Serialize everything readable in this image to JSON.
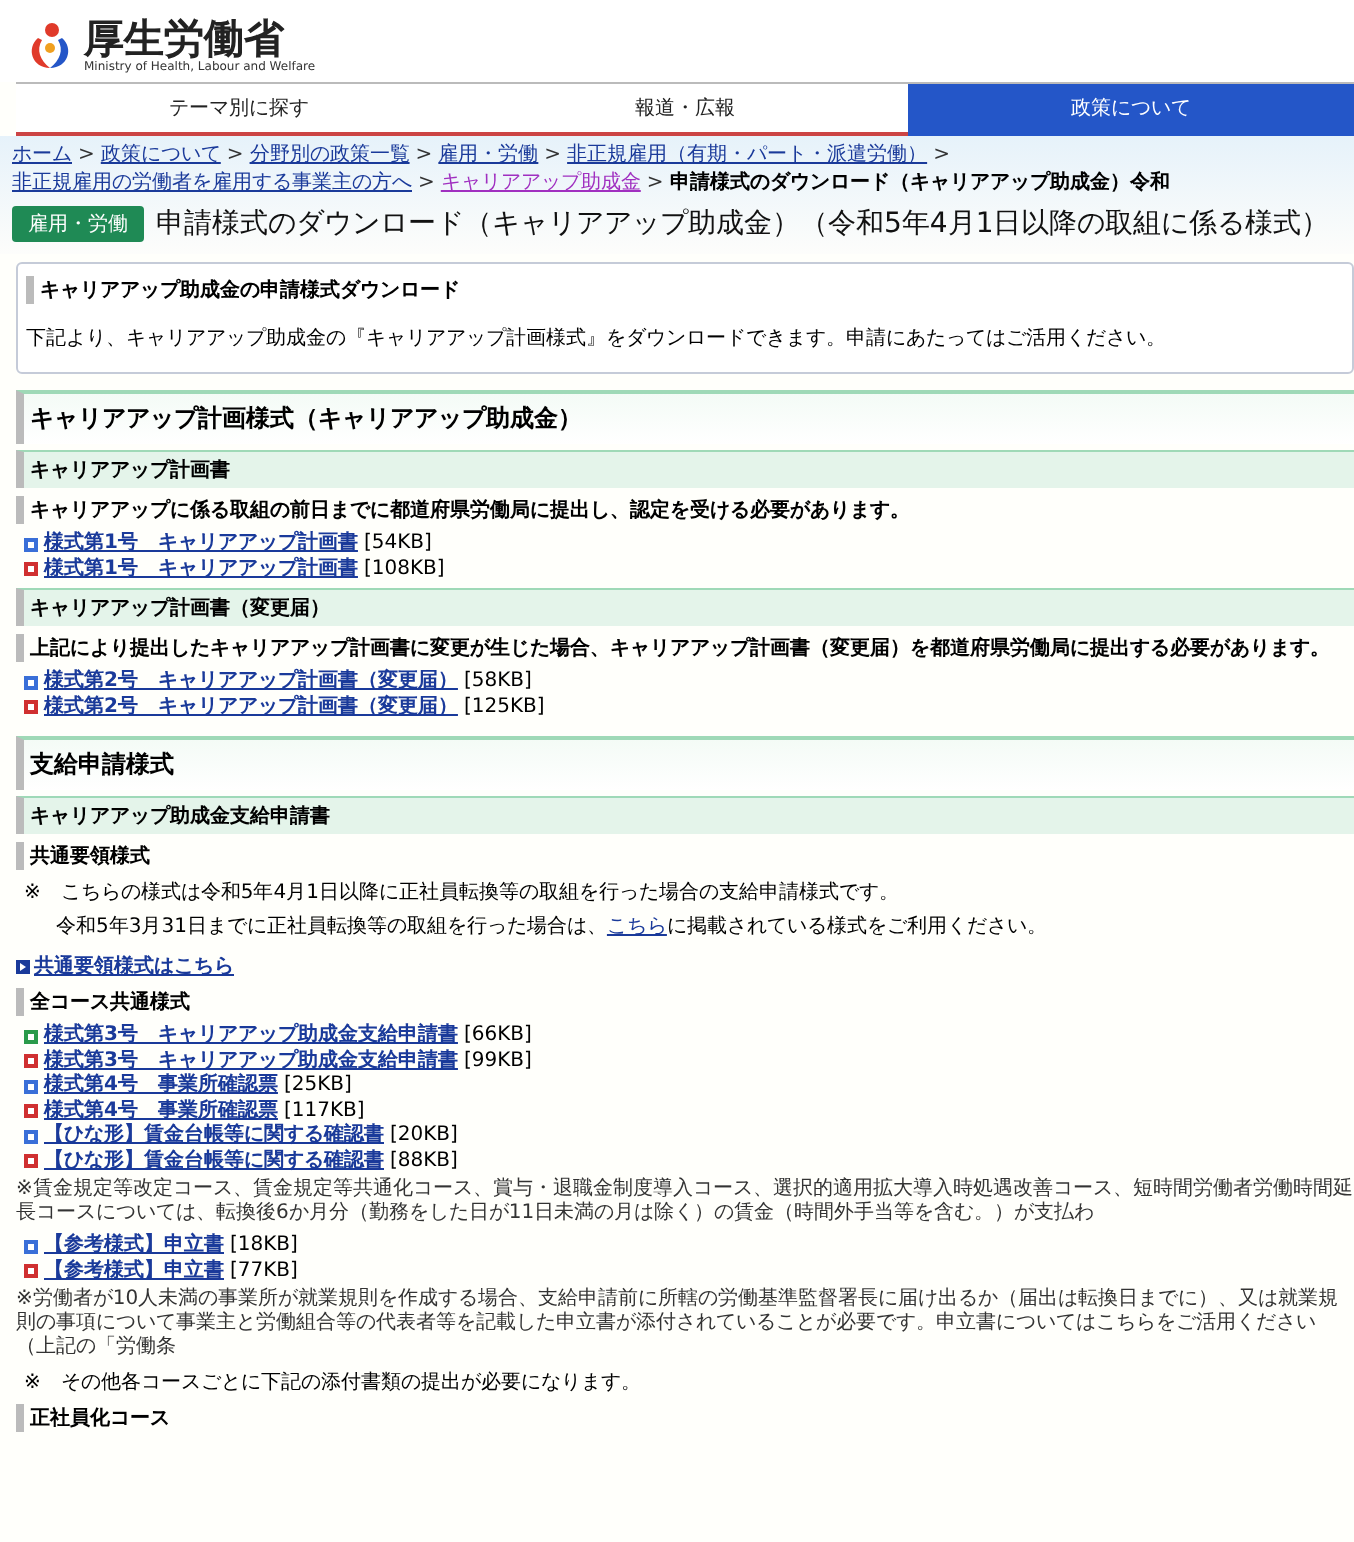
{
  "header": {
    "logo_title": "厚生労働省",
    "logo_subtitle": "Ministry of Health, Labour and Welfare"
  },
  "nav_tabs": [
    {
      "label": "テーマ別に探す",
      "selected": false
    },
    {
      "label": "報道・広報",
      "selected": false
    },
    {
      "label": "政策について",
      "selected": true
    }
  ],
  "breadcrumb": [
    {
      "label": "ホーム",
      "visited": false
    },
    {
      "label": "政策について",
      "visited": false
    },
    {
      "label": "分野別の政策一覧",
      "visited": false
    },
    {
      "label": "雇用・労働",
      "visited": false
    },
    {
      "label": "非正規雇用（有期・パート・派遣労働）",
      "visited": false
    },
    {
      "label": "非正規雇用の労働者を雇用する事業主の方へ",
      "visited": false
    },
    {
      "label": "キャリアアップ助成金",
      "visited": true
    }
  ],
  "breadcrumb_separator": ">",
  "breadcrumb_current": "申請様式のダウンロード（キャリアアップ助成金）令和",
  "category_badge": "雇用・労働",
  "page_title": "申請様式のダウンロード（キャリアアップ助成金）（令和5年4月1日以降の取組に係る様式）",
  "intro": {
    "heading": "キャリアアップ助成金の申請様式ダウンロード",
    "text": "下記より、キャリアアップ助成金の『キャリアアップ計画様式』をダウンロードできます。申請にあたってはご活用ください。"
  },
  "content": [
    {
      "kind": "h2",
      "text": "キャリアアップ計画様式（キャリアアップ助成金）"
    },
    {
      "kind": "h3",
      "text": "キャリアアップ計画書"
    },
    {
      "kind": "h4",
      "text": "キャリアアップに係る取組の前日までに都道府県労働局に提出し、認定を受ける必要があります。"
    },
    {
      "kind": "files",
      "files": [
        {
          "kind": "word",
          "label": "様式第1号　キャリアアップ計画書",
          "size": "[54KB]"
        },
        {
          "kind": "pdf",
          "label": "様式第1号　キャリアアップ計画書",
          "size": "[108KB]"
        }
      ]
    },
    {
      "kind": "h3",
      "text": "キャリアアップ計画書（変更届）"
    },
    {
      "kind": "h4",
      "text": "上記により提出したキャリアアップ計画書に変更が生じた場合、キャリアアップ計画書（変更届）を都道府県労働局に提出する必要があります。"
    },
    {
      "kind": "files",
      "files": [
        {
          "kind": "word",
          "label": "様式第2号　キャリアアップ計画書（変更届）",
          "size": "[58KB]"
        },
        {
          "kind": "pdf",
          "label": "様式第2号　キャリアアップ計画書（変更届）",
          "size": "[125KB]"
        }
      ]
    },
    {
      "kind": "h2",
      "text": "支給申請様式"
    },
    {
      "kind": "h3",
      "text": "キャリアアップ助成金支給申請書"
    },
    {
      "kind": "h4",
      "text": "共通要領様式"
    },
    {
      "kind": "note",
      "text": "※　こちらの様式は令和5年4月1日以降に正社員転換等の取組を行った場合の支給申請様式です。"
    },
    {
      "kind": "linkpara",
      "before": "令和5年3月31日までに正社員転換等の取組を行った場合は、",
      "link": "こちら",
      "after": "に掲載されている様式をご利用ください。"
    },
    {
      "kind": "arrowlink",
      "text": "共通要領様式はこちら"
    },
    {
      "kind": "h4",
      "text": "全コース共通様式"
    },
    {
      "kind": "files",
      "files": [
        {
          "kind": "excel",
          "label": "様式第3号　キャリアアップ助成金支給申請書",
          "size": "[66KB]"
        },
        {
          "kind": "pdf",
          "label": "様式第3号　キャリアアップ助成金支給申請書",
          "size": "[99KB]"
        },
        {
          "kind": "word",
          "label": "様式第4号　事業所確認票",
          "size": "[25KB]"
        },
        {
          "kind": "pdf",
          "label": "様式第4号　事業所確認票",
          "size": "[117KB]"
        },
        {
          "kind": "word",
          "label": "【ひな形】賃金台帳等に関する確認書",
          "size": "[20KB]"
        },
        {
          "kind": "pdf",
          "label": "【ひな形】賃金台帳等に関する確認書",
          "size": "[88KB]"
        }
      ]
    },
    {
      "kind": "smallnote",
      "text": "※賃金規定等改定コース、賃金規定等共通化コース、賞与・退職金制度導入コース、選択的適用拡大導入時処遇改善コース、短時間労働者労働時間延長コースについては、転換後6か月分（勤務をした日が11日未満の月は除く）の賃金（時間外手当等を含む。）が支払わ"
    },
    {
      "kind": "files",
      "files": [
        {
          "kind": "word",
          "label": "【参考様式】申立書",
          "size": "[18KB]"
        },
        {
          "kind": "pdf",
          "label": "【参考様式】申立書",
          "size": "[77KB]"
        }
      ]
    },
    {
      "kind": "smallnote",
      "text": "※労働者が10人未満の事業所が就業規則を作成する場合、支給申請前に所轄の労働基準監督署長に届け出るか（届出は転換日までに）、又は就業規則の事項について事業主と労働組合等の代表者等を記載した申立書が添付されていることが必要です。申立書についてはこちらをご活用ください（上記の「労働条"
    },
    {
      "kind": "note",
      "text": "※　その他各コースごとに下記の添付書類の提出が必要になります。"
    },
    {
      "kind": "h4",
      "text": "正社員化コース"
    }
  ]
}
